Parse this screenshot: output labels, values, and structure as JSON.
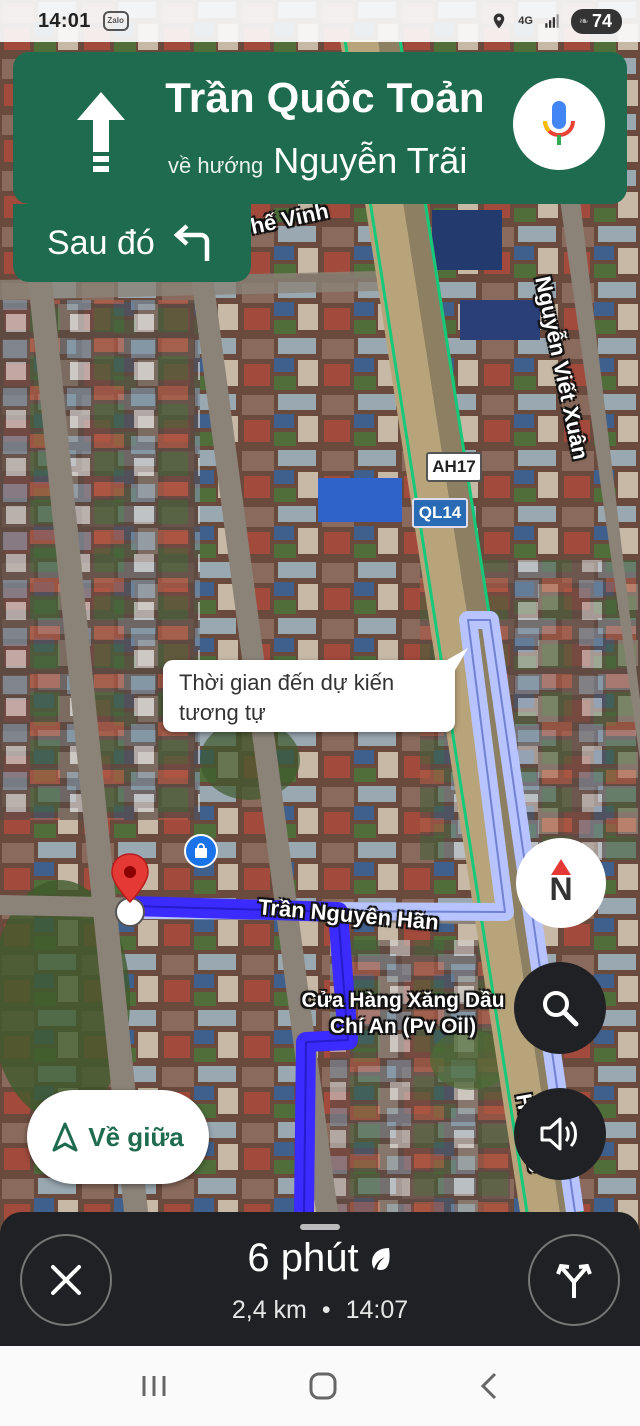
{
  "status_bar": {
    "time": "14:01",
    "app_badge": "Zalo",
    "network": "4G",
    "battery": "74"
  },
  "navigation": {
    "street": "Trần Quốc Toản",
    "toward_label": "về hướng",
    "toward_street": "Nguyễn Trãi",
    "then_label": "Sau đó",
    "maneuver_icon": "arrow-straight-icon",
    "then_icon": "turn-left-icon"
  },
  "map": {
    "street_labels": {
      "top_street": "hế Vinh",
      "right_street": "Nguyễn Viết Xuân",
      "route_street": "Trần Nguyên Hãn",
      "bottom_right_street": "Hù Đức"
    },
    "shields": {
      "ah": "AH17",
      "ql": "QL14"
    },
    "poi": "Cửa Hàng Xăng Dầu Chí An (Pv Oil)",
    "callout": "Thời gian đến dự kiến tương tự"
  },
  "controls": {
    "compass_label": "N",
    "recenter_label": "Về giữa"
  },
  "trip": {
    "duration": "6 phút",
    "distance": "2,4 km",
    "separator": "•",
    "arrival": "14:07"
  },
  "colors": {
    "nav_green": "#1e6b4f",
    "route_blue": "#3b2bff",
    "alt_route": "#b8c4ff",
    "dark_button": "#202124"
  }
}
